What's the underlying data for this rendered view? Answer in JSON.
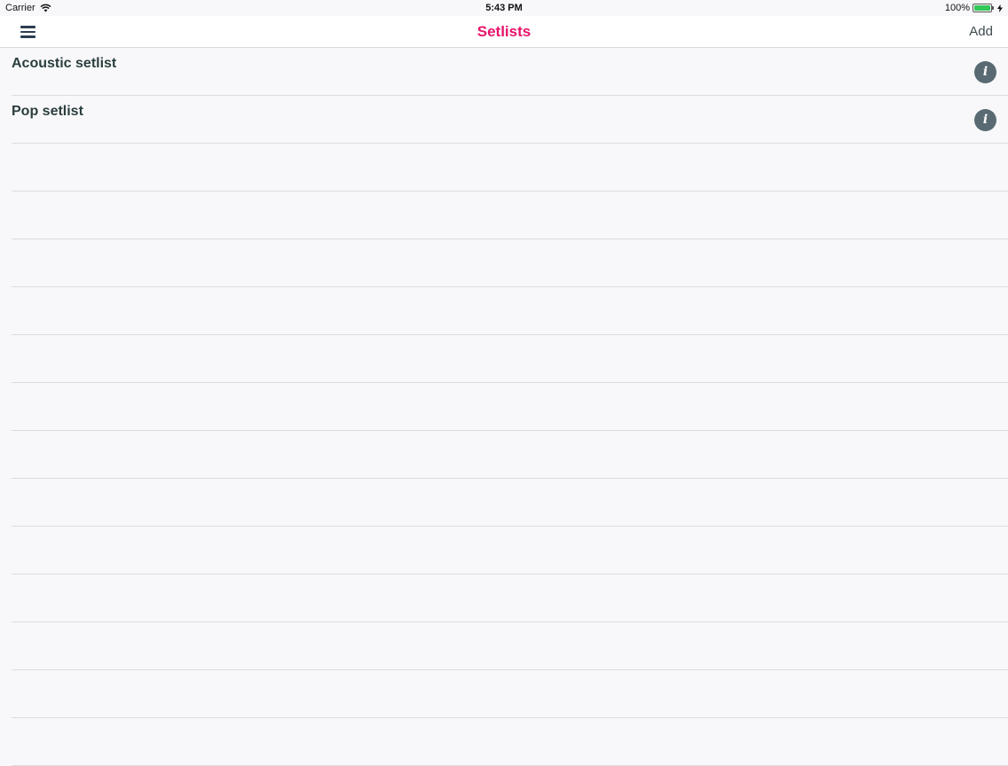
{
  "status_bar": {
    "carrier": "Carrier",
    "time": "5:43 PM",
    "battery": "100%"
  },
  "nav": {
    "title": "Setlists",
    "add_label": "Add",
    "title_color": "#e8136a"
  },
  "setlists": [
    {
      "title": "Acoustic setlist"
    },
    {
      "title": "Pop setlist"
    }
  ],
  "icons": {
    "menu": "hamburger-menu-icon",
    "info": "info-icon",
    "wifi": "wifi-icon",
    "battery": "battery-icon"
  }
}
